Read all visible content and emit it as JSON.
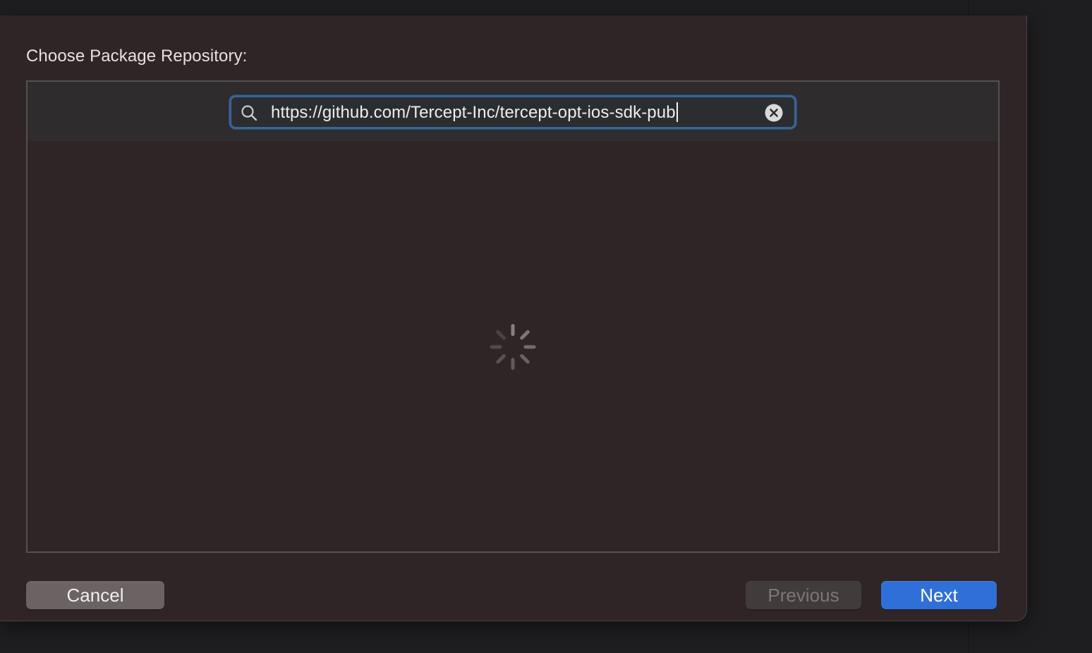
{
  "dialog": {
    "title": "Choose Package Repository:"
  },
  "search": {
    "value": "https://github.com/Tercept-Inc/tercept-opt-ios-sdk-pub",
    "icon": "search-icon",
    "clear_icon": "clear-circle-icon",
    "focus_color": "#3e6396"
  },
  "content": {
    "state": "loading",
    "indicator_icon": "spinner-icon"
  },
  "buttons": {
    "cancel_label": "Cancel",
    "previous_label": "Previous",
    "next_label": "Next",
    "next_color": "#2f6fd8"
  }
}
